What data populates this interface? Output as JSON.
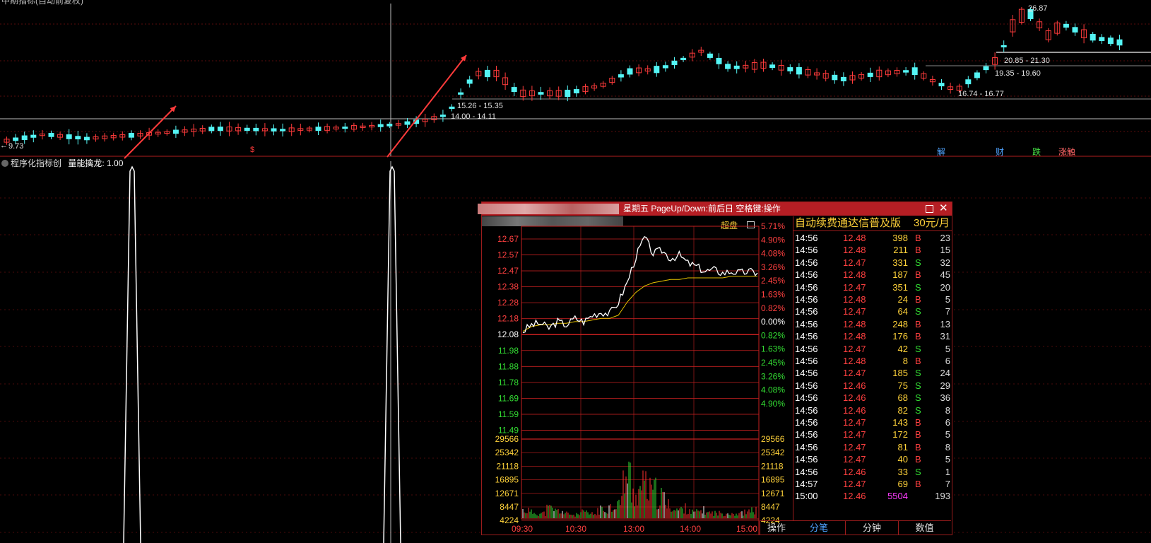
{
  "kline": {
    "top_left_text": "中期指标(自动前复权)",
    "levels": [
      "26.87",
      "20.85 - 21.30",
      "19.35 - 19.60",
      "16.74 - 16.77",
      "15.26 - 15.35",
      "14.00 - 14.11",
      "9.73"
    ],
    "news_tags": [
      {
        "label": "解",
        "color": "#4fa3ff"
      },
      {
        "label": "财",
        "color": "#4fa3ff"
      },
      {
        "label": "跌",
        "color": "#44dd44"
      },
      {
        "label": "涨触",
        "color": "#ff6666"
      }
    ],
    "dollar_mark": "$",
    "colors": {
      "up": "#ff3b3b",
      "down": "#54f5f5",
      "grid": "#5a0b0b",
      "arrow": "#ff3b3b"
    }
  },
  "indicator": {
    "name": "程序化指标创",
    "label": "量能擒龙:",
    "value": "1.00"
  },
  "popup": {
    "title_right": "星期五 PageUp/Down:前后日 空格键:操作",
    "superpan": "超盘",
    "price_labels": [
      "12.67",
      "12.57",
      "12.47",
      "12.38",
      "12.28",
      "12.18",
      "12.08",
      "11.98",
      "11.88",
      "11.78",
      "11.69",
      "11.59",
      "11.49"
    ],
    "pct_labels": [
      "5.71%",
      "4.90%",
      "4.08%",
      "3.26%",
      "2.45%",
      "1.63%",
      "0.82%",
      "0.00%",
      "0.82%",
      "1.63%",
      "2.45%",
      "3.26%",
      "4.08%",
      "4.90%"
    ],
    "vol_labels": [
      "29566",
      "25342",
      "21118",
      "16895",
      "12671",
      "8447",
      "4224"
    ],
    "time_labels": [
      "09:30",
      "10:30",
      "13:00",
      "14:00",
      "15:00"
    ],
    "operate_label": "操作",
    "chart_data": {
      "type": "line",
      "title": "",
      "series": [
        {
          "values": [
            12.1,
            12.14,
            12.15,
            12.12,
            12.16,
            12.14,
            12.18,
            12.16,
            12.2,
            12.22,
            12.21,
            12.28,
            12.4,
            12.56,
            12.68,
            12.58,
            12.6,
            12.55,
            12.57,
            12.52,
            12.5,
            12.47,
            12.48,
            12.46,
            12.47,
            12.46,
            12.47,
            12.46
          ]
        },
        {
          "values": [
            12.1,
            12.13,
            12.14,
            12.14,
            12.15,
            12.15,
            12.16,
            12.16,
            12.17,
            12.18,
            12.18,
            12.2,
            12.28,
            12.34,
            12.38,
            12.4,
            12.41,
            12.42,
            12.42,
            12.43,
            12.43,
            12.43,
            12.43,
            12.43,
            12.44,
            12.44,
            12.44,
            12.44
          ]
        }
      ],
      "volume": [
        4200,
        3100,
        2600,
        5100,
        3900,
        2400,
        1800,
        3000,
        2200,
        4400,
        6000,
        8200,
        22000,
        13000,
        17000,
        14000,
        11000,
        6800,
        4500,
        5200,
        3200,
        4100,
        2800,
        2600,
        2900,
        2400,
        3100,
        4300
      ],
      "ylim": [
        11.49,
        12.67
      ]
    }
  },
  "ticks": {
    "header_title": "自动续费通达信普及版",
    "header_price": "30元/月",
    "rows": [
      [
        "14:56",
        "12.48",
        "398",
        "B",
        "23"
      ],
      [
        "14:56",
        "12.48",
        "211",
        "B",
        "15"
      ],
      [
        "14:56",
        "12.47",
        "331",
        "S",
        "32"
      ],
      [
        "14:56",
        "12.48",
        "187",
        "B",
        "45"
      ],
      [
        "14:56",
        "12.47",
        "351",
        "S",
        "20"
      ],
      [
        "14:56",
        "12.48",
        "24",
        "B",
        "5"
      ],
      [
        "14:56",
        "12.47",
        "64",
        "S",
        "7"
      ],
      [
        "14:56",
        "12.48",
        "248",
        "B",
        "13"
      ],
      [
        "14:56",
        "12.48",
        "176",
        "B",
        "31"
      ],
      [
        "14:56",
        "12.47",
        "42",
        "S",
        "5"
      ],
      [
        "14:56",
        "12.48",
        "8",
        "B",
        "6"
      ],
      [
        "14:56",
        "12.47",
        "185",
        "S",
        "24"
      ],
      [
        "14:56",
        "12.46",
        "75",
        "S",
        "29"
      ],
      [
        "14:56",
        "12.46",
        "68",
        "S",
        "36"
      ],
      [
        "14:56",
        "12.46",
        "82",
        "S",
        "8"
      ],
      [
        "14:56",
        "12.47",
        "143",
        "B",
        "6"
      ],
      [
        "14:56",
        "12.47",
        "172",
        "B",
        "5"
      ],
      [
        "14:56",
        "12.47",
        "81",
        "B",
        "8"
      ],
      [
        "14:56",
        "12.47",
        "40",
        "B",
        "5"
      ],
      [
        "14:56",
        "12.46",
        "33",
        "S",
        "1"
      ],
      [
        "14:57",
        "12.47",
        "69",
        "B",
        "7"
      ],
      [
        "15:00",
        "12.46",
        "5504",
        "",
        "193"
      ]
    ],
    "tabs": [
      "分笔",
      "分钟",
      "数值"
    ]
  }
}
